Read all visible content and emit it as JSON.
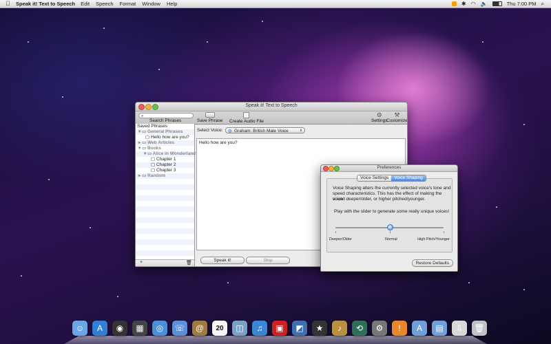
{
  "menubar": {
    "app_name": "Speak it! Text to Speech",
    "items": [
      "Edit",
      "Speech",
      "Format",
      "Window",
      "Help"
    ],
    "clock": "Thu 7:00 PM"
  },
  "main_window": {
    "title": "Speak it! Text to Speech",
    "search_label": "Search Phrases",
    "toolbar": {
      "save_phrase": "Save Phrase",
      "create_audio": "Create Audio File",
      "settings": "Settings",
      "customize": "Customize"
    },
    "sidebar": {
      "header": "Saved Phrases",
      "groups": {
        "general": "General Phrases",
        "hello": "Hello how are you?",
        "web": "Web Articles",
        "books": "Books",
        "alice": "Alice in Wonderland",
        "ch1": "Chapter 1",
        "ch2": "Chapter 2",
        "ch3": "Chapter 3",
        "random": "Random"
      },
      "add": "+",
      "delete": "🗑"
    },
    "voice_label": "Select Voice:",
    "voice_value": "Graham: British Male Voice",
    "text": "Hello how are you?",
    "speak_button": "Speak it!",
    "stop_button": "Stop"
  },
  "prefs": {
    "title": "Preferences",
    "tabs": [
      "Voice Settings",
      "Voice Shaping"
    ],
    "desc1": "Voice Shaping alters the currently selected voice's tone and",
    "desc2": "speed characteristics. This has the effect of making the voice",
    "desc3": "sound deeper/older, or higher pitched/younger.",
    "desc4": "Play with the slider to generate some really unique voices!",
    "labels": {
      "left": "Deeper/Older",
      "middle": "Normal",
      "right": "High Pitch/Younger"
    },
    "slider_value": 0.5,
    "restore": "Restore Defaults"
  },
  "dock": {
    "icons": [
      "finder-icon",
      "app-store-icon",
      "dashboard-icon",
      "mission-control-icon",
      "safari-icon",
      "facetime-icon",
      "address-book-icon",
      "ical-icon",
      "preview-icon",
      "itunes-icon",
      "photo-booth-icon",
      "iphoto-icon",
      "imovie-icon",
      "garageband-icon",
      "time-machine-icon",
      "system-preferences-icon",
      "speakit-icon",
      "applications-folder-icon",
      "documents-folder-icon",
      "downloads-icon",
      "trash-icon"
    ],
    "ical_date": "20"
  }
}
